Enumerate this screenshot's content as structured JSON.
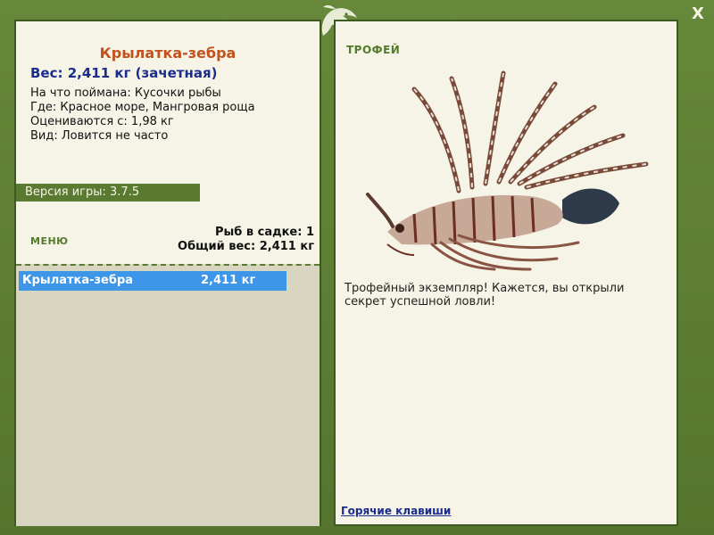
{
  "window": {
    "close_label": "X"
  },
  "fish": {
    "name": "Крылатка-зебра",
    "weight_line": "Вес: 2,411 кг (зачетная)",
    "bait_line": "На что поймана: Кусочки рыбы",
    "location_line": "Где: Красное море, Мангровая роща",
    "min_weight_line": "Оцениваются с: 1,98 кг",
    "rarity_line": "Вид: Ловится не часто"
  },
  "game": {
    "version_line": "Версия игры: 3.7.5"
  },
  "menu": {
    "label": "МЕНЮ"
  },
  "cage": {
    "count_line": "Рыб в садке: 1",
    "total_line": "Общий вес: 2,411 кг",
    "rows": [
      {
        "name": "Крылатка-зебра",
        "weight": "2,411 кг"
      }
    ],
    "selected_color": "#3d96e8"
  },
  "trophy": {
    "label": "ТРОФЕЙ",
    "description": "Трофейный экземпляр! Кажется, вы открыли секрет успешной ловли!"
  },
  "footer": {
    "hotkeys_link": "Горячие клавиши"
  },
  "colors": {
    "frame_green": "#5a7a32",
    "panel_bg": "#f5f4e6",
    "title_orange": "#c4501c",
    "weight_blue": "#1a2c8c"
  },
  "icons": {
    "logo": "fish-logo-icon",
    "close": "close-icon"
  }
}
